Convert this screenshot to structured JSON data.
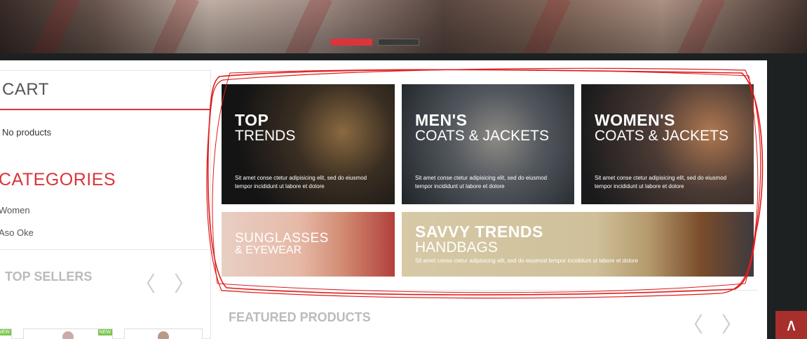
{
  "hero": {
    "slides": [
      {
        "state": "active"
      },
      {
        "state": "inactive"
      }
    ]
  },
  "sidebar": {
    "cart": {
      "title": "CART",
      "empty_text": "No products"
    },
    "categories": {
      "title": "CATEGORIES",
      "items": [
        "Women",
        "Aso Oke"
      ]
    },
    "top_sellers": {
      "title": "TOP SELLERS",
      "badge": "NEW"
    }
  },
  "banners": [
    {
      "heading": "TOP",
      "subheading": "TRENDS",
      "desc": "Sit amet conse ctetur adipisicing elit, sed do eiusmod tempor incididunt ut labore et dolore"
    },
    {
      "heading": "MEN'S",
      "subheading": "COATS & JACKETS",
      "desc": "Sit amet conse ctetur adipisicing elit, sed do eiusmod tempor incididunt ut labore et dolore"
    },
    {
      "heading": "WOMEN'S",
      "subheading": "COATS & JACKETS",
      "desc": "Sit amet conse ctetur adipisicing elit, sed do eiusmod tempor incididunt ut labore et dolore"
    },
    {
      "heading": "SUNGLASSES",
      "subheading": "& EYEWEAR",
      "desc": ""
    },
    {
      "heading": "SAVVY TRENDS",
      "subheading": "HANDBAGS",
      "desc": "Sit amet conse ctetur adipisicing elit, sed do eiusmod tempor incididunt ut labore et dolore"
    }
  ],
  "featured": {
    "title": "FEATURED PRODUCTS"
  },
  "colors": {
    "accent": "#d9353b",
    "dark": "#1e2122",
    "back_to_top": "#a8302c"
  },
  "icons": {
    "prev": "chevron-left-icon",
    "next": "chevron-right-icon",
    "back_to_top": "chevron-up-icon"
  }
}
